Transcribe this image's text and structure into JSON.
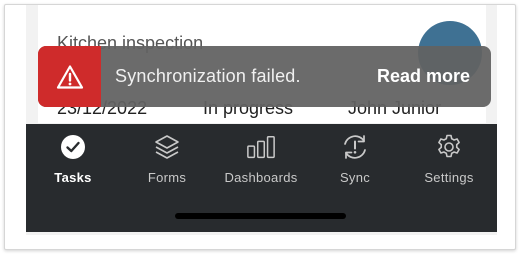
{
  "card": {
    "title": "Kitchen inspection",
    "date": "23/12/2022",
    "status": "In progress",
    "assignee": "John Junior",
    "avatar_color": "#3f7193"
  },
  "toast": {
    "icon": "warning-triangle-icon",
    "message": "Synchronization failed.",
    "action_label": "Read more",
    "icon_bg": "#cf2b2b"
  },
  "tabbar": {
    "active": "tasks",
    "items": [
      {
        "id": "tasks",
        "label": "Tasks",
        "icon": "check-circle-icon"
      },
      {
        "id": "forms",
        "label": "Forms",
        "icon": "layers-icon"
      },
      {
        "id": "dashboards",
        "label": "Dashboards",
        "icon": "bar-chart-icon"
      },
      {
        "id": "sync",
        "label": "Sync",
        "icon": "sync-alert-icon"
      },
      {
        "id": "settings",
        "label": "Settings",
        "icon": "gear-icon"
      }
    ]
  }
}
